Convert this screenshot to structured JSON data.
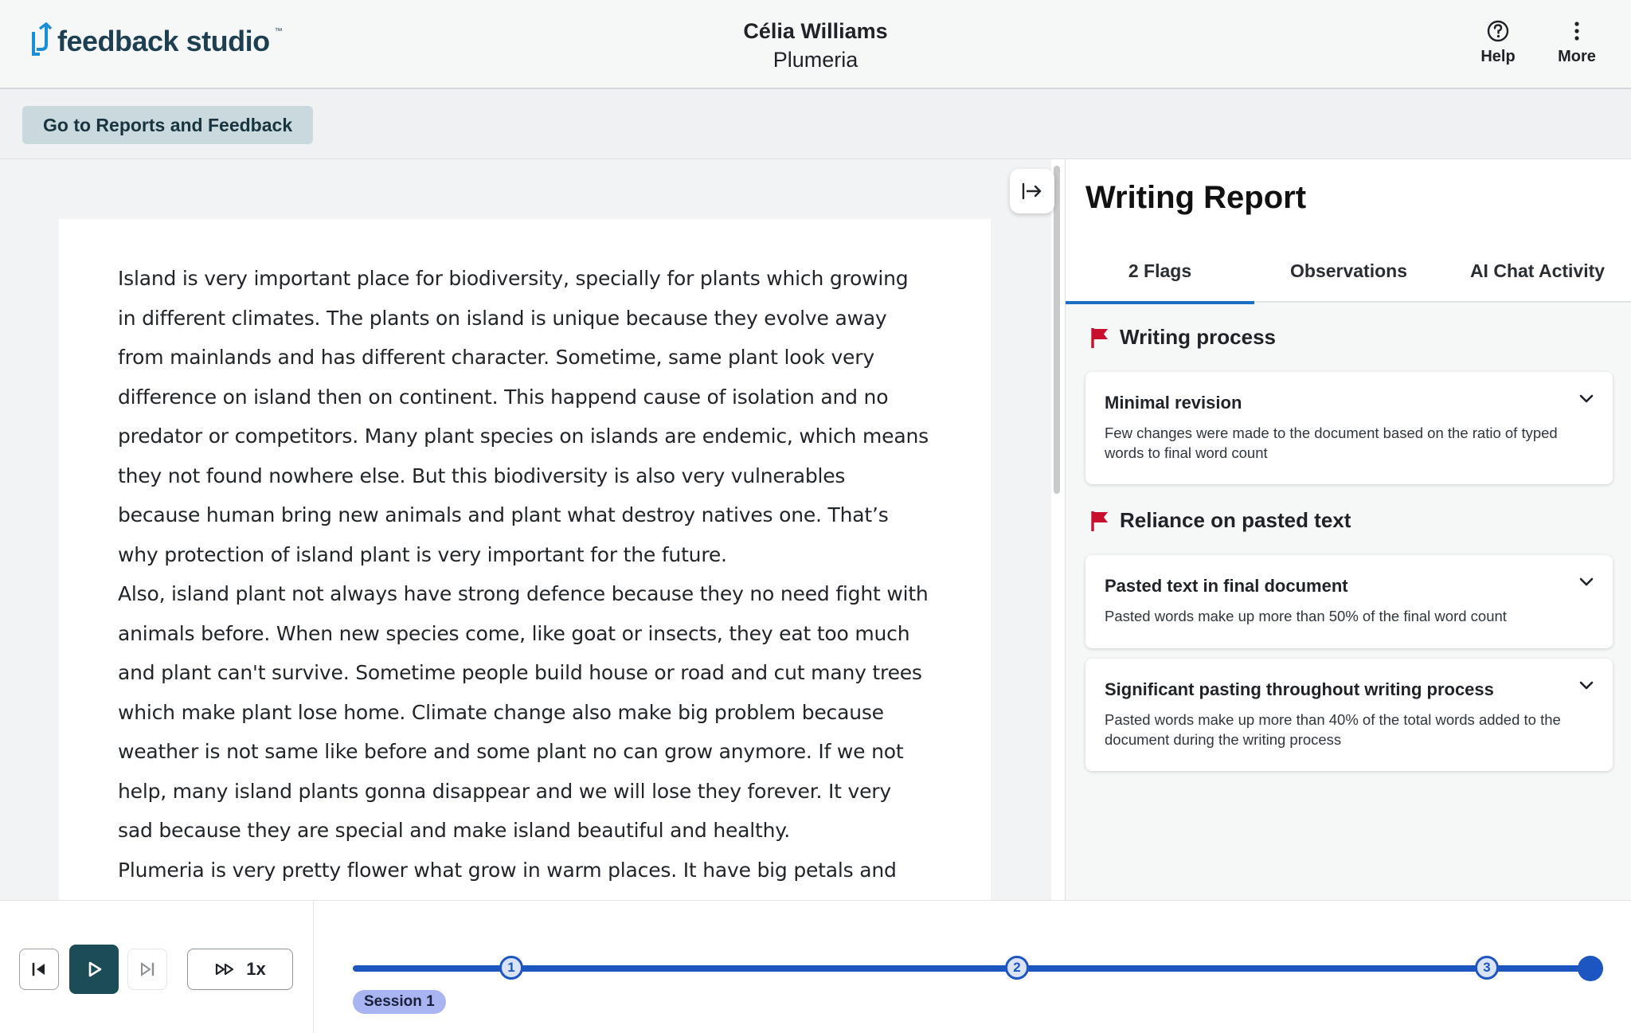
{
  "header": {
    "logo_text": "feedback studio",
    "student_name": "Célia Williams",
    "document_title": "Plumeria",
    "help_label": "Help",
    "more_label": "More"
  },
  "subbar": {
    "reports_button": "Go to Reports and Feedback"
  },
  "document": {
    "paragraphs": [
      "Island is very important place for biodiversity, specially for plants which growing in different climates. The plants on island is unique because they evolve away from mainlands and has different character. Sometime, same plant look very difference on island then on continent. This happend cause of isolation and no predator or competitors. Many plant species on islands are endemic, which means they not found nowhere else. But this biodiversity is also very vulnerables because human bring new animals and plant what destroy natives one. That’s why protection of island plant is very important for the future.",
      "Also, island plant not always have strong defence because they no need fight with animals before. When new species come, like goat or insects, they eat too much and plant can't survive. Sometime people build house or road and cut many trees which make plant lose home. Climate change also make big problem because weather is not same like before and some plant no can grow anymore. If we not help, many island plants gonna disappear and we will lose they forever. It very sad because they are special and make island beautiful and healthy.",
      "Plumeria is very pretty flower what grow in warm places. It have big petals and smell"
    ]
  },
  "report": {
    "title": "Writing Report",
    "tabs": [
      {
        "label": "2 Flags",
        "active": true
      },
      {
        "label": "Observations",
        "active": false
      },
      {
        "label": "AI Chat Activity",
        "active": false
      }
    ],
    "sections": [
      {
        "heading": "Writing process",
        "cards": [
          {
            "title": "Minimal revision",
            "description": "Few changes were made to the document based on the ratio of typed words to final word count"
          }
        ]
      },
      {
        "heading": "Reliance on pasted text",
        "cards": [
          {
            "title": "Pasted text in final document",
            "description": "Pasted words make up more than 50% of the final word count"
          },
          {
            "title": "Significant pasting throughout writing process",
            "description": "Pasted words make up more than 40% of the total words added to the document during the writing process"
          }
        ]
      }
    ],
    "flag_color": "#c8102e"
  },
  "player": {
    "speed_label": "1x",
    "markers": [
      "1",
      "2",
      "3"
    ],
    "session_label": "Session 1",
    "progress": 1.0,
    "accent_color": "#1d56c1"
  }
}
